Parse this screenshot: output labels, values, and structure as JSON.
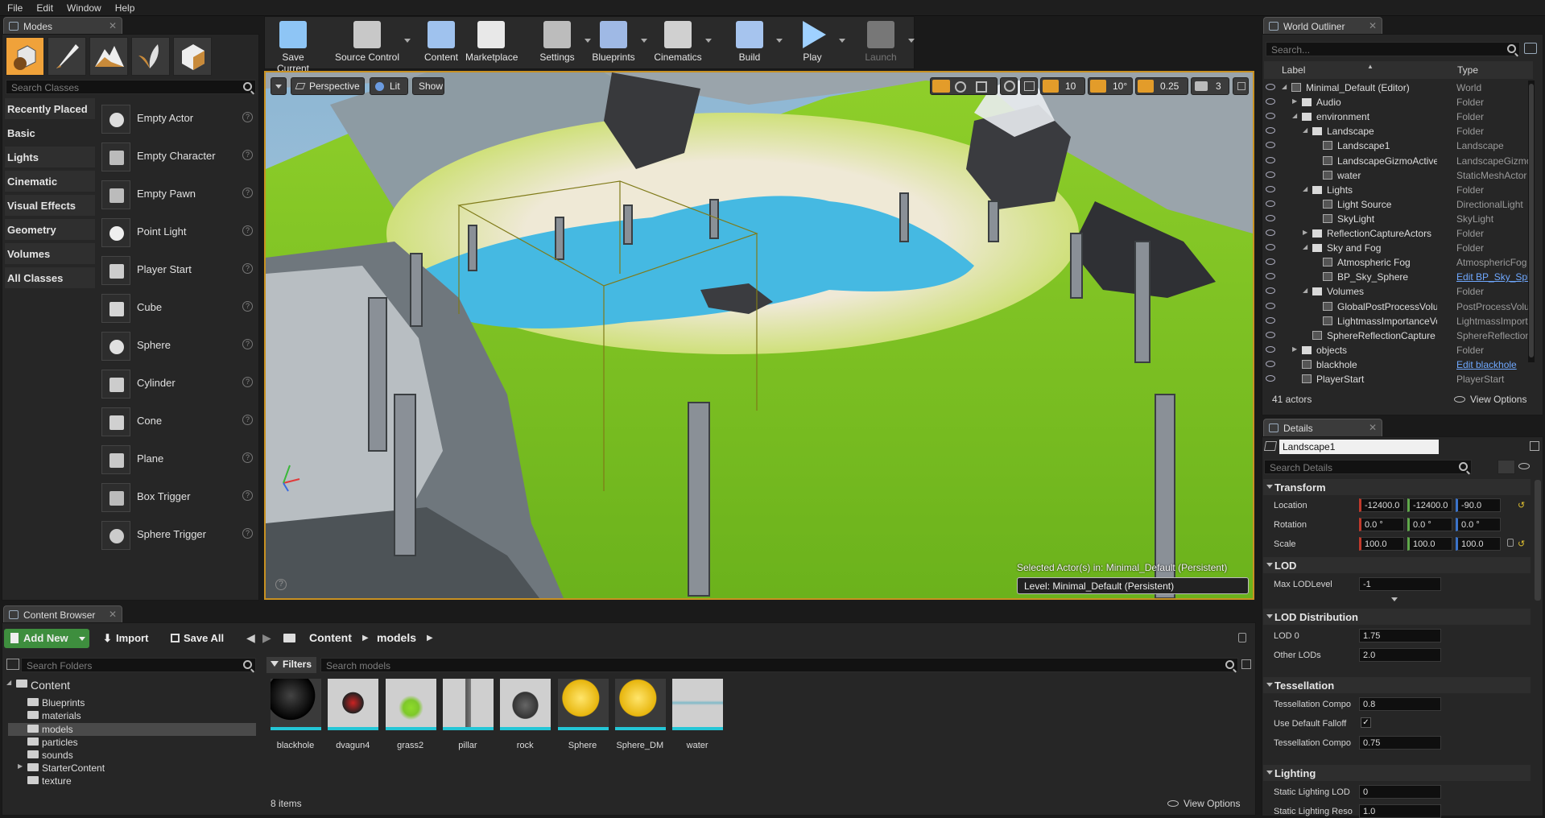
{
  "menu": [
    "File",
    "Edit",
    "Window",
    "Help"
  ],
  "modes": {
    "tab_label": "Modes",
    "search_placeholder": "Search Classes",
    "mode_icons": [
      "place-mode-icon",
      "paint-mode-icon",
      "landscape-mode-icon",
      "foliage-mode-icon",
      "geometry-mode-icon"
    ],
    "categories": [
      "Recently Placed",
      "Basic",
      "Lights",
      "Cinematic",
      "Visual Effects",
      "Geometry",
      "Volumes",
      "All Classes"
    ],
    "selected_category": "Basic",
    "items": [
      "Empty Actor",
      "Empty Character",
      "Empty Pawn",
      "Point Light",
      "Player Start",
      "Cube",
      "Sphere",
      "Cylinder",
      "Cone",
      "Plane",
      "Box Trigger",
      "Sphere Trigger"
    ]
  },
  "toolbar": {
    "buttons": [
      {
        "label": "Save Current",
        "icon": "save-icon"
      },
      {
        "label": "Source Control",
        "icon": "source-control-icon"
      },
      {
        "label": "Content",
        "icon": "content-icon"
      },
      {
        "label": "Marketplace",
        "icon": "marketplace-icon"
      },
      {
        "label": "Settings",
        "icon": "settings-icon"
      },
      {
        "label": "Blueprints",
        "icon": "blueprints-icon"
      },
      {
        "label": "Cinematics",
        "icon": "cinematics-icon"
      },
      {
        "label": "Build",
        "icon": "build-icon"
      },
      {
        "label": "Play",
        "icon": "play-icon"
      },
      {
        "label": "Launch",
        "icon": "launch-icon"
      }
    ]
  },
  "viewport": {
    "perspective_label": "Perspective",
    "lit_label": "Lit",
    "show_label": "Show",
    "grid_snap": "10",
    "rotation_snap": "10°",
    "scale_snap": "0.25",
    "camera_speed": "3",
    "selected_actor_text": "Selected Actor(s) in:  Minimal_Default (Persistent)",
    "level_text": "Level:  Minimal_Default (Persistent)"
  },
  "outliner": {
    "tab_label": "World Outliner",
    "search_placeholder": "Search...",
    "col_label": "Label",
    "col_type": "Type",
    "rows": [
      {
        "label": "Minimal_Default (Editor)",
        "type": "World",
        "indent": 0
      },
      {
        "label": "Audio",
        "type": "Folder",
        "indent": 1
      },
      {
        "label": "environment",
        "type": "Folder",
        "indent": 1
      },
      {
        "label": "Landscape",
        "type": "Folder",
        "indent": 2
      },
      {
        "label": "Landscape1",
        "type": "Landscape",
        "indent": 3
      },
      {
        "label": "LandscapeGizmoActiveActor",
        "type": "LandscapeGizmo",
        "indent": 3
      },
      {
        "label": "water",
        "type": "StaticMeshActor",
        "indent": 3
      },
      {
        "label": "Lights",
        "type": "Folder",
        "indent": 2
      },
      {
        "label": "Light Source",
        "type": "DirectionalLight",
        "indent": 3
      },
      {
        "label": "SkyLight",
        "type": "SkyLight",
        "indent": 3
      },
      {
        "label": "ReflectionCaptureActors",
        "type": "Folder",
        "indent": 2
      },
      {
        "label": "Sky and Fog",
        "type": "Folder",
        "indent": 2
      },
      {
        "label": "Atmospheric Fog",
        "type": "AtmosphericFog",
        "indent": 3
      },
      {
        "label": "BP_Sky_Sphere",
        "type": "Edit BP_Sky_Sphere",
        "indent": 3,
        "link": true
      },
      {
        "label": "Volumes",
        "type": "Folder",
        "indent": 2
      },
      {
        "label": "GlobalPostProcessVolume",
        "type": "PostProcessVolume",
        "indent": 3
      },
      {
        "label": "LightmassImportanceVolume",
        "type": "LightmassImportanceVolume",
        "indent": 3
      },
      {
        "label": "SphereReflectionCapture",
        "type": "SphereReflectionCapture",
        "indent": 2
      },
      {
        "label": "objects",
        "type": "Folder",
        "indent": 1
      },
      {
        "label": "blackhole",
        "type": "Edit blackhole",
        "indent": 1,
        "link": true
      },
      {
        "label": "PlayerStart",
        "type": "PlayerStart",
        "indent": 1
      }
    ],
    "actor_count": "41 actors",
    "view_options": "View Options"
  },
  "details": {
    "tab_label": "Details",
    "object_name": "Landscape1",
    "search_placeholder": "Search Details",
    "transform_label": "Transform",
    "location_label": "Location",
    "rotation_label": "Rotation",
    "scale_label": "Scale",
    "location": [
      "-12400.0",
      "-12400.0",
      "-90.0"
    ],
    "rotation": [
      "0.0 °",
      "0.0 °",
      "0.0 °"
    ],
    "scale": [
      "100.0",
      "100.0",
      "100.0"
    ],
    "lod_label": "LOD",
    "max_lod_label": "Max LODLevel",
    "max_lod_value": "-1",
    "lod_dist_label": "LOD Distribution",
    "lod0_label": "LOD 0",
    "lod0_value": "1.75",
    "other_lods_label": "Other LODs",
    "other_lods_value": "2.0",
    "tess_label": "Tessellation",
    "tess_comp_label": "Tessellation Compo",
    "tess_comp_value": "0.8",
    "default_falloff_label": "Use Default Falloff",
    "tess_comp2_label": "Tessellation Compo",
    "tess_comp2_value": "0.75",
    "lighting_label": "Lighting",
    "static_lod_label": "Static Lighting LOD",
    "static_lod_value": "0",
    "static_res_label": "Static Lighting Reso",
    "static_res_value": "1.0"
  },
  "content_browser": {
    "tab_label": "Content Browser",
    "add_new": "Add New",
    "import": "Import",
    "save_all": "Save All",
    "path": [
      "Content",
      "models"
    ],
    "search_folders": "Search Folders",
    "filters": "Filters",
    "search_assets": "Search models",
    "tree": [
      {
        "label": "Content",
        "indent": 0,
        "root": true
      },
      {
        "label": "Blueprints",
        "indent": 1
      },
      {
        "label": "materials",
        "indent": 1
      },
      {
        "label": "models",
        "indent": 1,
        "selected": true
      },
      {
        "label": "particles",
        "indent": 1
      },
      {
        "label": "sounds",
        "indent": 1
      },
      {
        "label": "StarterContent",
        "indent": 1
      },
      {
        "label": "texture",
        "indent": 1
      }
    ],
    "assets": [
      "blackhole",
      "dvagun4",
      "grass2",
      "pillar",
      "rock",
      "Sphere",
      "Sphere_DM",
      "water"
    ],
    "item_count": "8 items",
    "view_options": "View Options"
  }
}
